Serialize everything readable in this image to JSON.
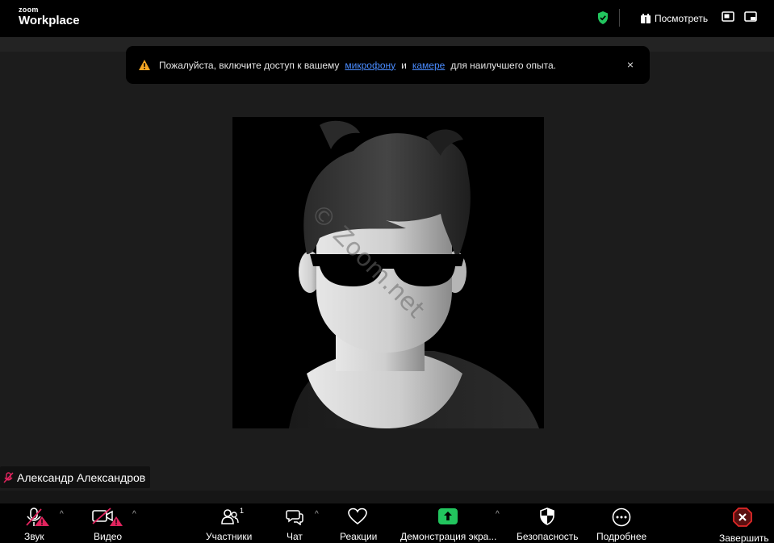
{
  "topbar": {
    "brand_small": "zoom",
    "brand_big": "Workplace",
    "view_label": "Посмотреть"
  },
  "notice": {
    "text_before": "Пожалуйста, включите доступ к вашему",
    "link_mic": "микрофону",
    "text_and": "и",
    "link_camera": "камере",
    "text_after": "для наилучшего опыта.",
    "close": "×"
  },
  "video": {
    "watermark": "© Zoom.net"
  },
  "participant": {
    "name": "Александр Александров"
  },
  "toolbar": {
    "audio": "Звук",
    "video": "Видео",
    "participants": "Участники",
    "participants_count": "1",
    "chat": "Чат",
    "reactions": "Реакции",
    "share": "Демонстрация экра...",
    "security": "Безопасность",
    "more": "Подробнее",
    "end": "Завершить"
  },
  "colors": {
    "accent_green": "#22c55e",
    "link_blue": "#4a8cff",
    "warn_orange": "#f5a623",
    "alert_red": "#e0245e",
    "end_red": "#e02828"
  },
  "icons": [
    "shield-check-icon",
    "calendar-view-icon",
    "picture-in-picture-icon",
    "minimize-window-icon",
    "warning-icon",
    "mic-off-icon",
    "video-off-icon",
    "participants-icon",
    "chat-icon",
    "reactions-heart-icon",
    "share-screen-icon",
    "security-shield-icon",
    "more-ellipsis-icon",
    "end-call-icon"
  ]
}
